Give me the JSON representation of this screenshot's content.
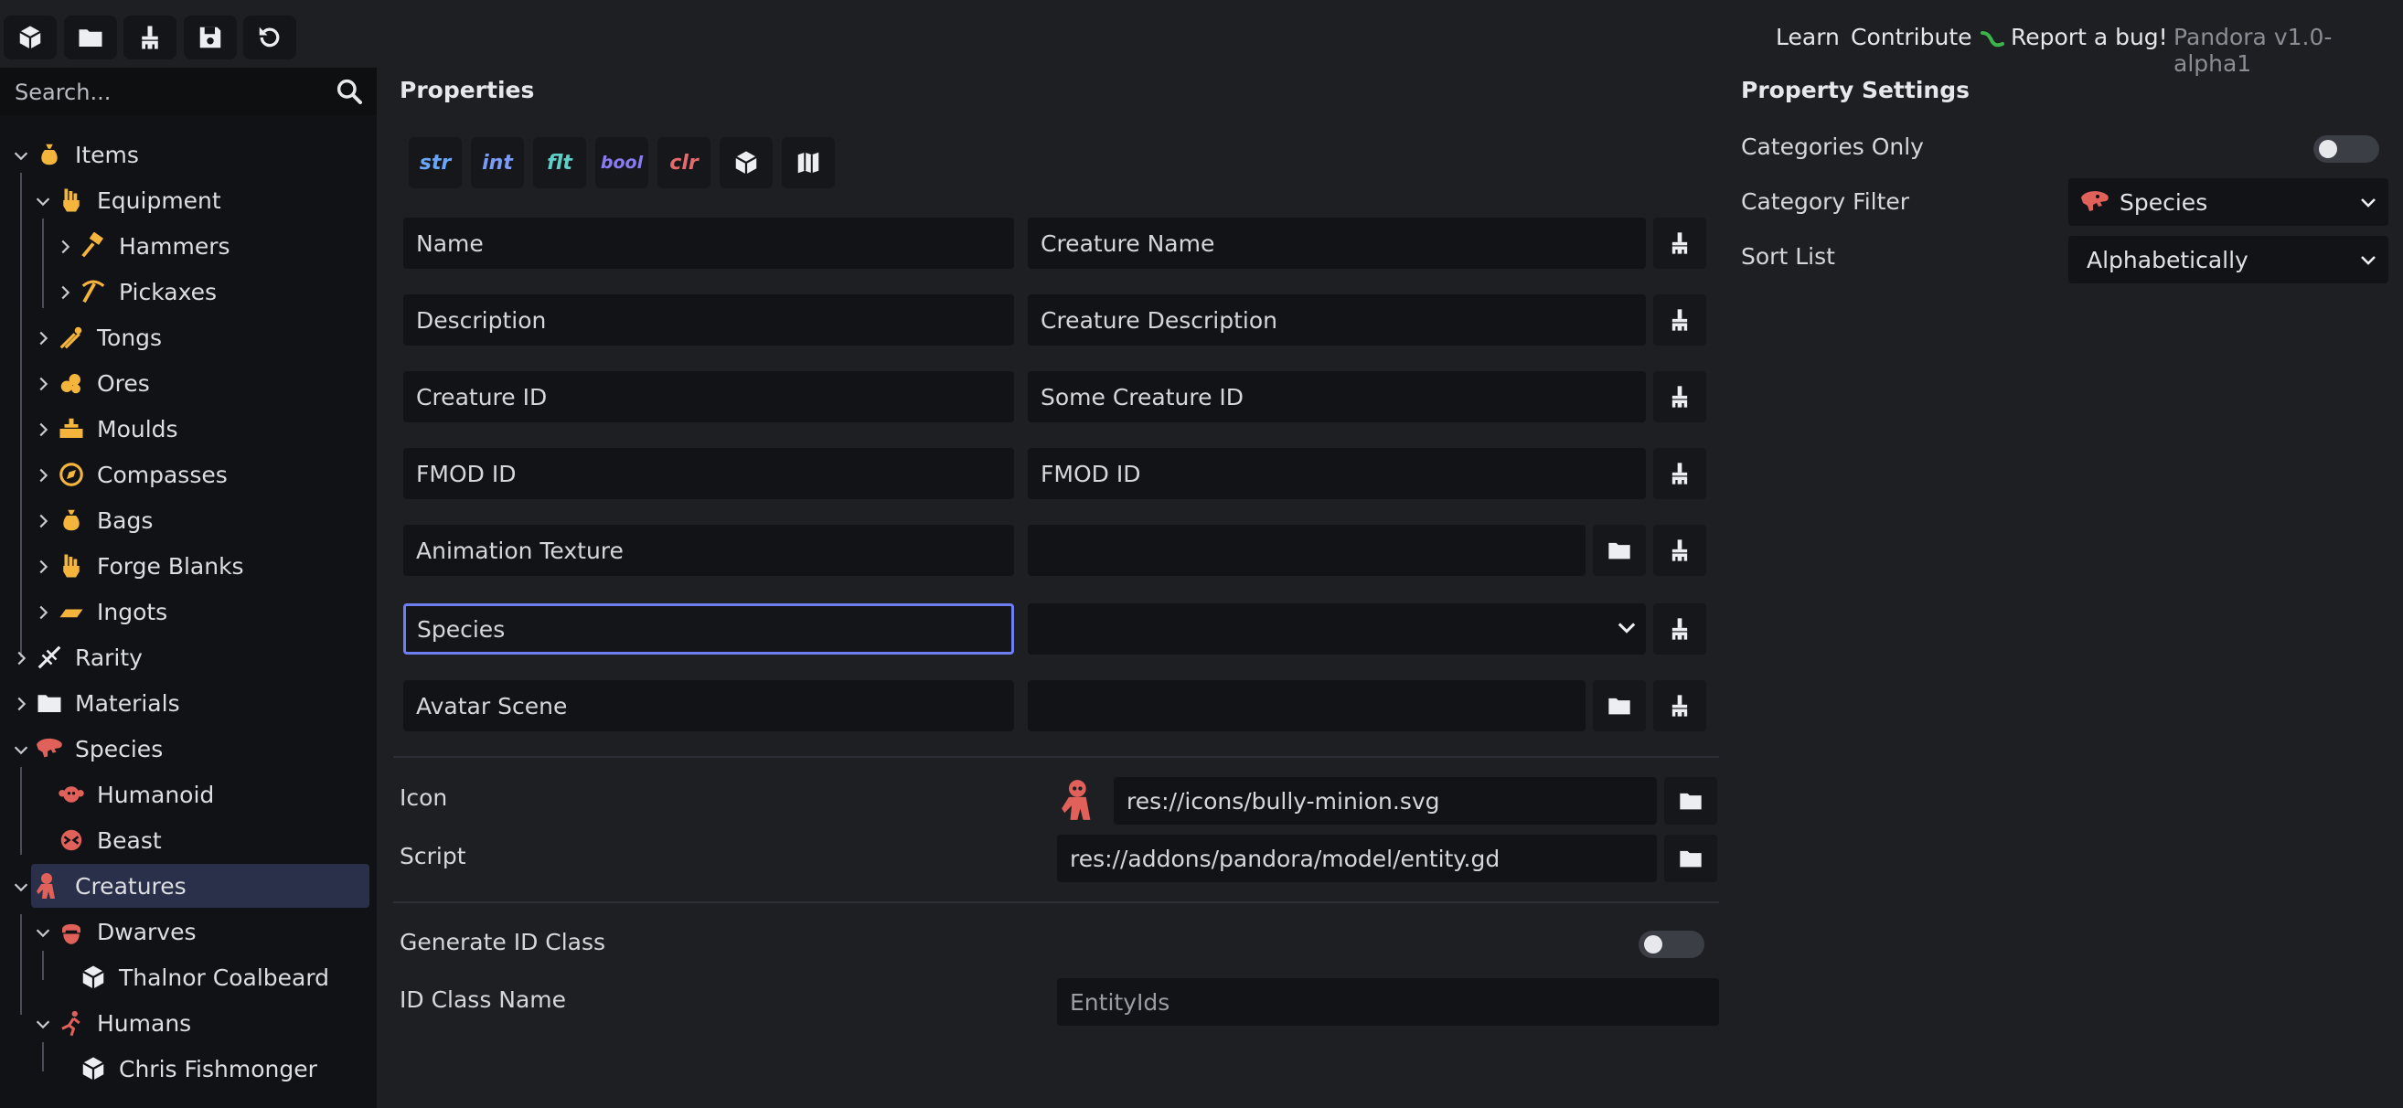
{
  "toolbar": {
    "buttons": [
      {
        "name": "new-entity-button",
        "icon": "cube-icon"
      },
      {
        "name": "new-category-button",
        "icon": "folder-icon"
      },
      {
        "name": "clear-button",
        "icon": "broom-icon"
      },
      {
        "name": "save-button",
        "icon": "save-icon"
      },
      {
        "name": "reset-button",
        "icon": "undo-icon"
      }
    ]
  },
  "header": {
    "learn": "Learn",
    "contribute": "Contribute",
    "report_bug": "Report a bug!",
    "version": "Pandora v1.0-alpha1"
  },
  "search": {
    "placeholder": "Search..."
  },
  "tree": {
    "items": [
      {
        "label": "Items",
        "icon": "moneybag-icon"
      },
      {
        "label": "Equipment",
        "icon": "fist-icon"
      },
      {
        "label": "Hammers",
        "icon": "hammer-icon"
      },
      {
        "label": "Pickaxes",
        "icon": "pickaxe-icon"
      },
      {
        "label": "Tongs",
        "icon": "tongs-icon"
      },
      {
        "label": "Ores",
        "icon": "ore-icon"
      },
      {
        "label": "Moulds",
        "icon": "mould-icon"
      },
      {
        "label": "Compasses",
        "icon": "compass-icon"
      },
      {
        "label": "Bags",
        "icon": "bag-icon"
      },
      {
        "label": "Forge Blanks",
        "icon": "fist-icon"
      },
      {
        "label": "Ingots",
        "icon": "ingot-icon"
      },
      {
        "label": "Rarity",
        "icon": "rarity-icon"
      },
      {
        "label": "Materials",
        "icon": "folder-icon"
      },
      {
        "label": "Species",
        "icon": "dino-skull-icon"
      },
      {
        "label": "Humanoid",
        "icon": "monkey-icon"
      },
      {
        "label": "Beast",
        "icon": "beast-icon"
      },
      {
        "label": "Creatures",
        "icon": "minion-icon"
      },
      {
        "label": "Dwarves",
        "icon": "dwarf-icon"
      },
      {
        "label": "Thalnor Coalbeard",
        "icon": "cube-icon"
      },
      {
        "label": "Humans",
        "icon": "running-man-icon"
      },
      {
        "label": "Chris Fishmonger",
        "icon": "cube-icon"
      }
    ]
  },
  "properties": {
    "title": "Properties",
    "type_buttons": [
      {
        "label": "str",
        "color": "#6aa6f8"
      },
      {
        "label": "int",
        "color": "#7b9cf6"
      },
      {
        "label": "flt",
        "color": "#5fd0c8"
      },
      {
        "label": "bool",
        "color": "#8a7cf2"
      },
      {
        "label": "clr",
        "color": "#e46b6b"
      }
    ],
    "rows": [
      {
        "name": "Name",
        "value": "Creature Name"
      },
      {
        "name": "Description",
        "value": "Creature Description"
      },
      {
        "name": "Creature ID",
        "value": "Some Creature ID"
      },
      {
        "name": "FMOD ID",
        "value": "FMOD ID"
      },
      {
        "name": "Animation Texture",
        "value": ""
      },
      {
        "name": "Species",
        "value": ""
      },
      {
        "name": "Avatar Scene",
        "value": ""
      }
    ],
    "icon_label": "Icon",
    "icon_path": "res://icons/bully-minion.svg",
    "script_label": "Script",
    "script_path": "res://addons/pandora/model/entity.gd",
    "generate_id_label": "Generate ID Class",
    "generate_id_enabled": false,
    "id_class_label": "ID Class Name",
    "id_class_value": "EntityIds"
  },
  "settings": {
    "title": "Property Settings",
    "categories_only_label": "Categories Only",
    "categories_only_enabled": false,
    "category_filter_label": "Category Filter",
    "category_filter_value": "Species",
    "sort_list_label": "Sort List",
    "sort_list_value": "Alphabetically"
  },
  "colors": {
    "accent": "#6e7ef0",
    "selected_row": "#2a2f4a",
    "icon_orange": "#f5b53d",
    "icon_red": "#e0605a"
  }
}
